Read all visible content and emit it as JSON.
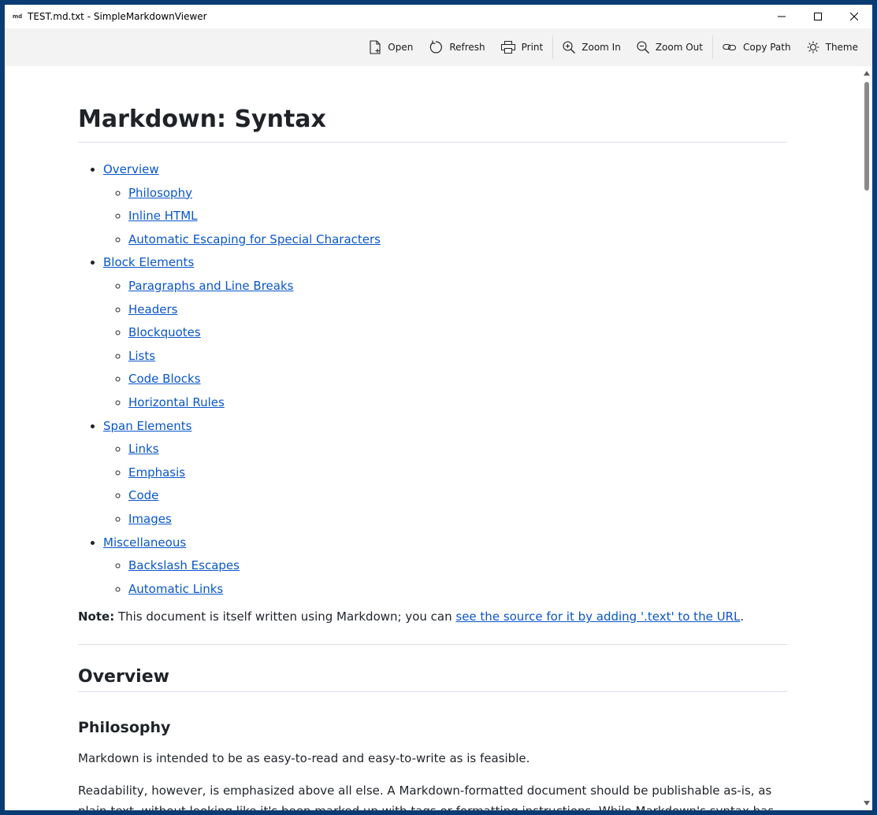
{
  "window": {
    "app_icon_text": "md",
    "title": "TEST.md.txt - SimpleMarkdownViewer"
  },
  "toolbar": {
    "open": "Open",
    "refresh": "Refresh",
    "print": "Print",
    "zoom_in": "Zoom In",
    "zoom_out": "Zoom Out",
    "copy_path": "Copy Path",
    "theme": "Theme"
  },
  "document": {
    "title": "Markdown: Syntax",
    "toc": [
      {
        "label": "Overview",
        "children": [
          "Philosophy",
          "Inline HTML",
          "Automatic Escaping for Special Characters"
        ]
      },
      {
        "label": "Block Elements",
        "children": [
          "Paragraphs and Line Breaks",
          "Headers",
          "Blockquotes",
          "Lists",
          "Code Blocks",
          "Horizontal Rules"
        ]
      },
      {
        "label": "Span Elements",
        "children": [
          "Links",
          "Emphasis",
          "Code",
          "Images"
        ]
      },
      {
        "label": "Miscellaneous",
        "children": [
          "Backslash Escapes",
          "Automatic Links"
        ]
      }
    ],
    "note_label": "Note:",
    "note_text": " This document is itself written using Markdown; you can ",
    "note_link": "see the source for it by adding '.text' to the URL",
    "note_end": ".",
    "overview_heading": "Overview",
    "philosophy_heading": "Philosophy",
    "para1": "Markdown is intended to be as easy-to-read and easy-to-write as is feasible.",
    "para2": "Readability, however, is emphasized above all else. A Markdown-formatted document should be publishable as-is, as plain text, without looking like it's been marked up with tags or formatting instructions. While Markdown's syntax has been influenced by"
  },
  "colors": {
    "link": "#0a56c8",
    "toolbar_bg": "#f3f3f3",
    "desktop": "#0b3b73"
  }
}
